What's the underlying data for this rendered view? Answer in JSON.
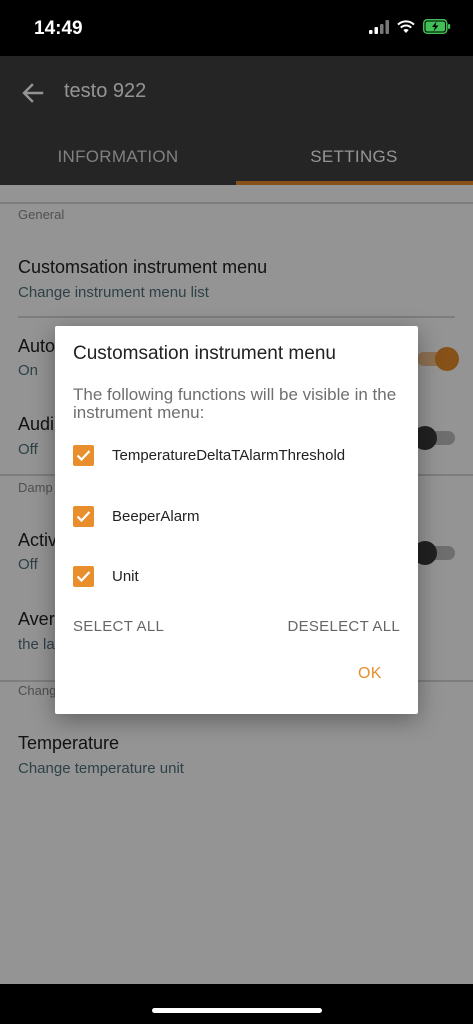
{
  "status_bar": {
    "time": "14:49"
  },
  "app_bar": {
    "title": "testo 922",
    "tabs": [
      {
        "label": "INFORMATION",
        "selected": false
      },
      {
        "label": "SETTINGS",
        "selected": true
      }
    ]
  },
  "settings": {
    "general_label": "General",
    "rows": [
      {
        "title": "Customsation instrument menu",
        "subtitle": "Change instrument menu list"
      },
      {
        "title": "Auto",
        "subtitle": "On",
        "switch": "on"
      },
      {
        "title": "Audi",
        "subtitle": "Off",
        "switch": "off"
      },
      {
        "title": "Activ",
        "subtitle": "Off",
        "switch": "off"
      },
      {
        "title": "Aver",
        "subtitle": "the la"
      },
      {
        "title": "Temperature",
        "subtitle": "Change temperature unit"
      }
    ],
    "damping_label": "Damp",
    "change_label": "Chang"
  },
  "dialog": {
    "title": "Customsation instrument menu",
    "message": "The following functions will be visible in the instrument menu:",
    "options": [
      {
        "label": "TemperatureDeltaTAlarmThreshold",
        "checked": true
      },
      {
        "label": "BeeperAlarm",
        "checked": true
      },
      {
        "label": "Unit",
        "checked": true
      }
    ],
    "select_all": "SELECT ALL",
    "deselect_all": "DESELECT ALL",
    "ok": "OK"
  },
  "colors": {
    "accent": "#e98e2c",
    "app_bar": "#404040"
  }
}
